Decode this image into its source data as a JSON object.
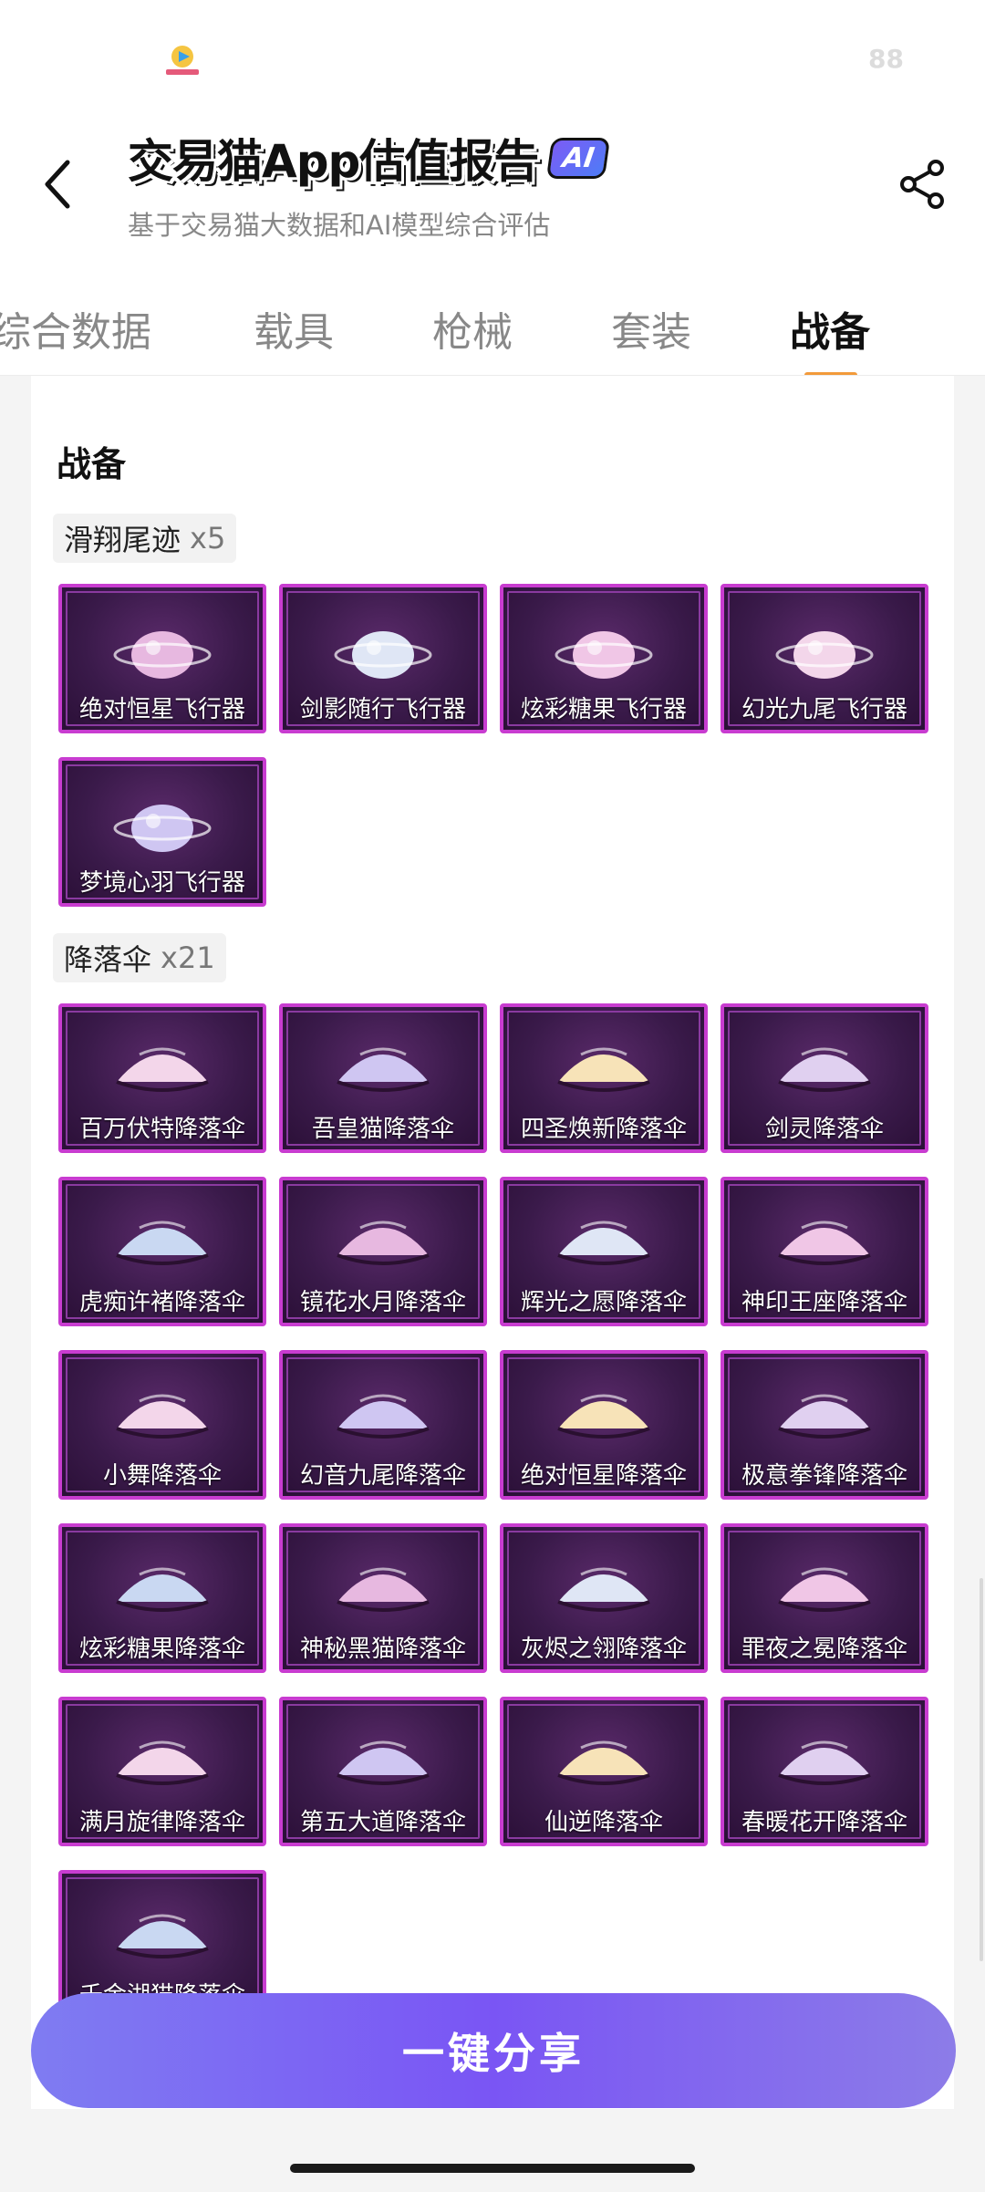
{
  "status_bar": {
    "counter": "88"
  },
  "header": {
    "title": "交易猫App估值报告",
    "ai_badge": "AI",
    "subtitle": "基于交易猫大数据和AI模型综合评估"
  },
  "tabs": [
    {
      "label": "综合数据"
    },
    {
      "label": "载具"
    },
    {
      "label": "枪械"
    },
    {
      "label": "套装"
    },
    {
      "label": "战备",
      "active": true
    }
  ],
  "section": {
    "title": "战备"
  },
  "categories": [
    {
      "name": "滑翔尾迹",
      "count": "x5",
      "items": [
        "绝对恒星飞行器",
        "剑影随行飞行器",
        "炫彩糖果飞行器",
        "幻光九尾飞行器",
        "梦境心羽飞行器"
      ]
    },
    {
      "name": "降落伞",
      "count": "x21",
      "items": [
        "百万伏特降落伞",
        "吾皇猫降落伞",
        "四圣焕新降落伞",
        "剑灵降落伞",
        "虎痴许褚降落伞",
        "镜花水月降落伞",
        "辉光之愿降落伞",
        "神印王座降落伞",
        "小舞降落伞",
        "幻音九尾降落伞",
        "绝对恒星降落伞",
        "极意拳锋降落伞",
        "炫彩糖果降落伞",
        "神秘黑猫降落伞",
        "灰烬之翎降落伞",
        "罪夜之冕降落伞",
        "满月旋律降落伞",
        "第五大道降落伞",
        "仙逆降落伞",
        "春暖花开降落伞",
        "千金湖猫降落伞"
      ]
    }
  ],
  "share_button": {
    "label": "一键分享"
  },
  "colors": {
    "accent": "#f29a3a",
    "item_border": "#c83cd0",
    "share_gradient_start": "#7f7cf2",
    "share_gradient_end": "#8c7ce8"
  }
}
